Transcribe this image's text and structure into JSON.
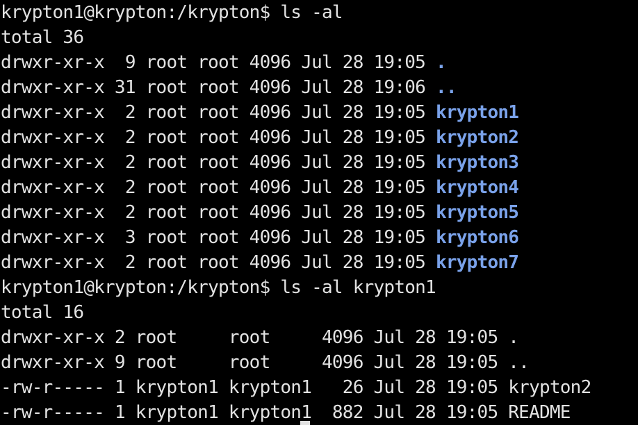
{
  "colors": {
    "background": "#000000",
    "text": "#e2e2e2",
    "directory": "#7aa2ea"
  },
  "prompt": "krypton1@krypton:/krypton$ ",
  "commands": {
    "first": "ls -al",
    "second": "ls -al krypton1"
  },
  "listing1": {
    "total": "total 36",
    "rows": [
      {
        "meta": "drwxr-xr-x  9 root root 4096 Jul 28 19:05 ",
        "name": "."
      },
      {
        "meta": "drwxr-xr-x 31 root root 4096 Jul 28 19:06 ",
        "name": ".."
      },
      {
        "meta": "drwxr-xr-x  2 root root 4096 Jul 28 19:05 ",
        "name": "krypton1"
      },
      {
        "meta": "drwxr-xr-x  2 root root 4096 Jul 28 19:05 ",
        "name": "krypton2"
      },
      {
        "meta": "drwxr-xr-x  2 root root 4096 Jul 28 19:05 ",
        "name": "krypton3"
      },
      {
        "meta": "drwxr-xr-x  2 root root 4096 Jul 28 19:05 ",
        "name": "krypton4"
      },
      {
        "meta": "drwxr-xr-x  2 root root 4096 Jul 28 19:05 ",
        "name": "krypton5"
      },
      {
        "meta": "drwxr-xr-x  3 root root 4096 Jul 28 19:05 ",
        "name": "krypton6"
      },
      {
        "meta": "drwxr-xr-x  2 root root 4096 Jul 28 19:05 ",
        "name": "krypton7"
      }
    ]
  },
  "listing2": {
    "total": "total 16",
    "rows": [
      {
        "meta": "drwxr-xr-x 2 root     root     4096 Jul 28 19:05 ",
        "name": "."
      },
      {
        "meta": "drwxr-xr-x 9 root     root     4096 Jul 28 19:05 ",
        "name": ".."
      },
      {
        "meta": "-rw-r----- 1 krypton1 krypton1   26 Jul 28 19:05 ",
        "name": "krypton2"
      },
      {
        "meta": "-rw-r----- 1 krypton1 krypton1  882 Jul 28 19:05 ",
        "name": "README"
      }
    ]
  }
}
